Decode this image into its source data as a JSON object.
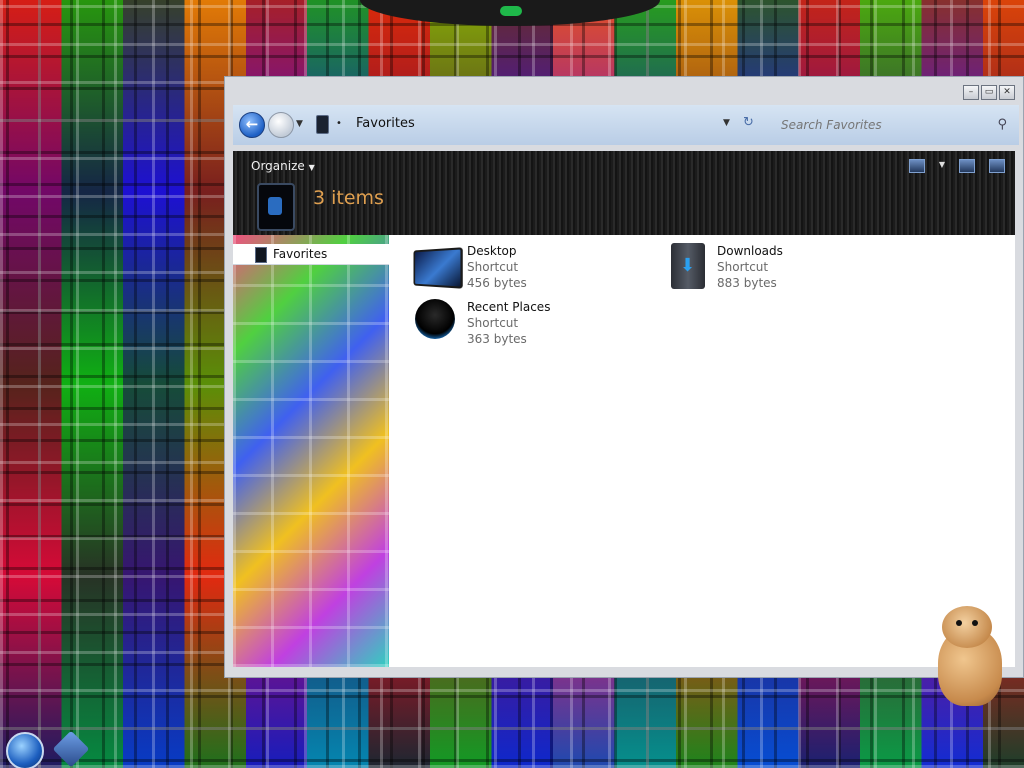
{
  "window": {
    "title_controls": {
      "minimize": "–",
      "restore": "▭",
      "close": "✕"
    }
  },
  "address_bar": {
    "location": "Favorites",
    "search_placeholder": "Search Favorites"
  },
  "toolbar": {
    "organize_label": "Organize"
  },
  "details": {
    "item_count": "3 items"
  },
  "nav_pane": {
    "items": [
      {
        "label": "Favorites"
      }
    ]
  },
  "files": [
    {
      "name": "Desktop",
      "type": "Shortcut",
      "size": "456 bytes",
      "icon": "desktop-icon"
    },
    {
      "name": "Downloads",
      "type": "Shortcut",
      "size": "883 bytes",
      "icon": "downloads-folder-icon"
    },
    {
      "name": "Recent Places",
      "type": "Shortcut",
      "size": "363 bytes",
      "icon": "recent-places-icon"
    }
  ],
  "colors": {
    "address_bar": "#c5d7ec",
    "toolbar": "#1e1e1e",
    "item_count": "#e0a050",
    "accent_blue": "#1d5fc4"
  }
}
